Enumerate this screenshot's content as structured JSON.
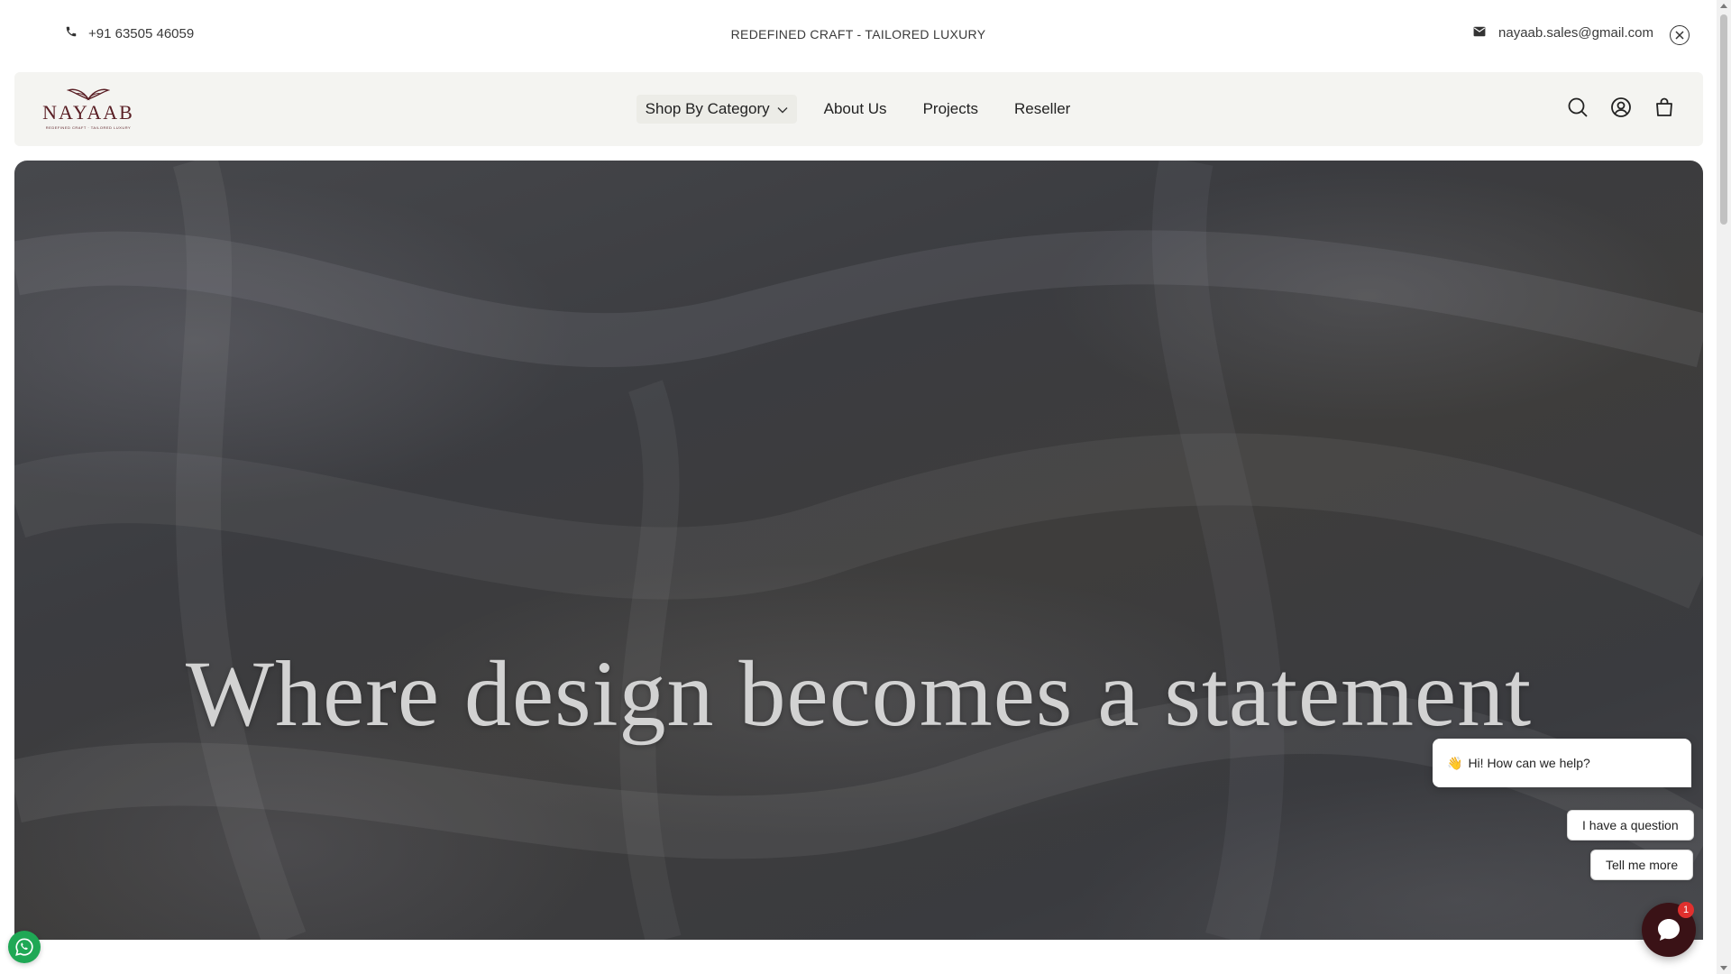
{
  "announcement": {
    "phone": "+91 63505 46059",
    "tagline": "REDEFINED CRAFT - TAILORED LUXURY",
    "email": "nayaab.sales@gmail.com",
    "phone_icon": "phone-icon",
    "email_icon": "mail-icon",
    "close_icon": "close-circle-icon"
  },
  "header": {
    "logo_text": "NAYAAB",
    "logo_subtext": "REDEFINED CRAFT · TAILORED LUXURY",
    "nav": [
      {
        "label": "Shop By Category",
        "has_dropdown": true
      },
      {
        "label": "About Us"
      },
      {
        "label": "Projects"
      },
      {
        "label": "Reseller"
      }
    ],
    "icons": [
      "search-icon",
      "account-icon",
      "cart-icon"
    ]
  },
  "hero": {
    "title": "Where design becomes a statement"
  },
  "chat": {
    "greeting_emoji": "👋",
    "greeting": "Hi! How can we help?",
    "options": [
      "I have a question",
      "Tell me more"
    ],
    "badge_count": "1"
  },
  "colors": {
    "brand": "#5a1f25",
    "chat_launcher": "#3a1216",
    "badge": "#e0302e",
    "whatsapp": "#1fa855",
    "header_bg": "#f4f4f1"
  }
}
